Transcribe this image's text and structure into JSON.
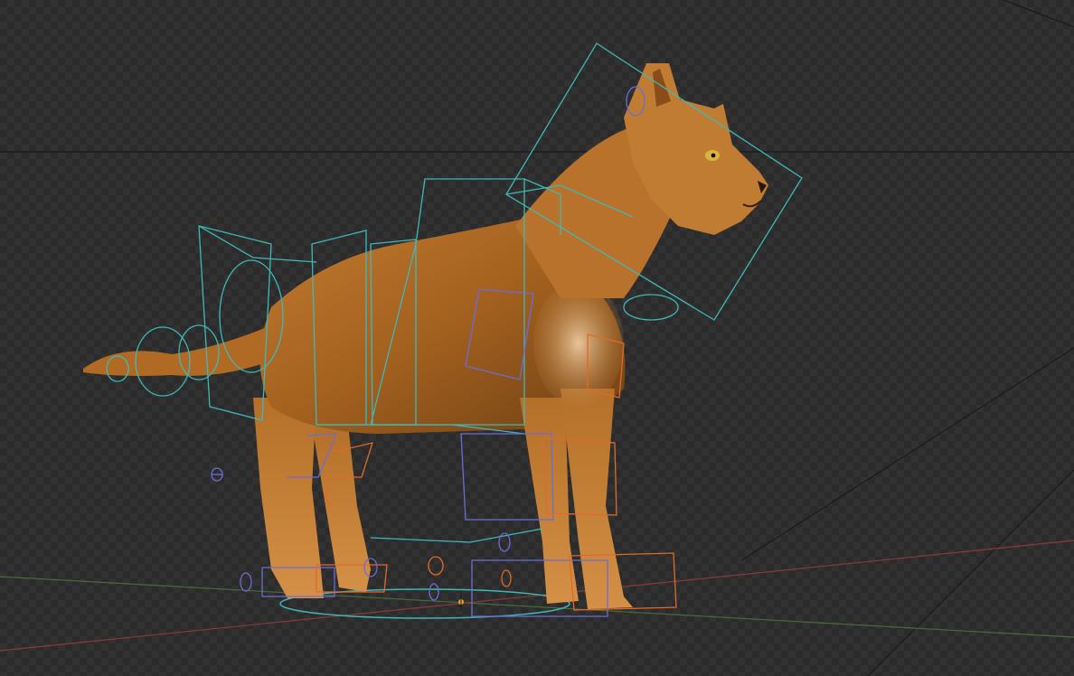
{
  "viewport": {
    "mode": "rendered-viewport",
    "background": "transparent-checkerboard"
  },
  "scene": {
    "subject": "cat",
    "rig_overlay": true
  },
  "colors": {
    "checker_dark": "#2b2b2b",
    "checker_light": "#323232",
    "bone_cyan": "#3fb8b8",
    "bone_blue": "#6c6cd8",
    "bone_orange": "#e06a28",
    "axis_x_red": "#8a3a3a",
    "axis_y_green": "#4a6a3a",
    "horizon_line": "#1a1a1a",
    "fur_base": "#b06a24",
    "fur_highlight": "#e8a24a",
    "eye": "#d8b440"
  },
  "icons": {
    "origin_marker": "origin-dot-icon"
  }
}
